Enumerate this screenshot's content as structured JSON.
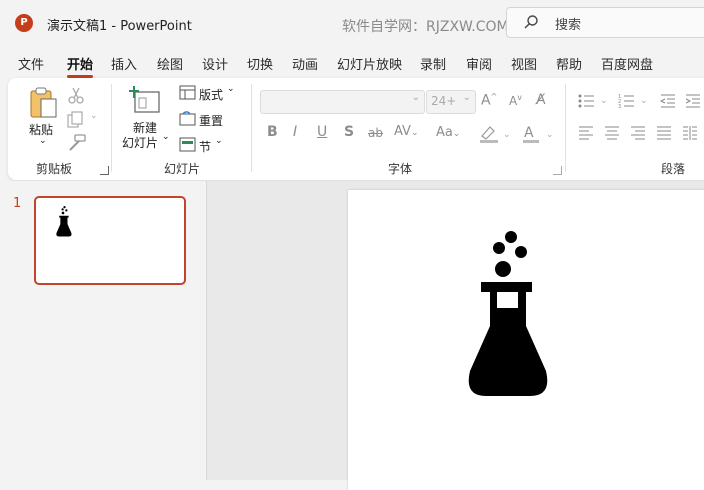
{
  "titlebar": {
    "app_badge": "P",
    "doc_title": "演示文稿1  -  PowerPoint",
    "watermark": "软件自学网：RJZXW.COM",
    "search_placeholder": "搜索"
  },
  "tabs": [
    {
      "label": "文件"
    },
    {
      "label": "开始",
      "active": true
    },
    {
      "label": "插入"
    },
    {
      "label": "绘图"
    },
    {
      "label": "设计"
    },
    {
      "label": "切换"
    },
    {
      "label": "动画"
    },
    {
      "label": "幻灯片放映"
    },
    {
      "label": "录制"
    },
    {
      "label": "审阅"
    },
    {
      "label": "视图"
    },
    {
      "label": "帮助"
    },
    {
      "label": "百度网盘"
    }
  ],
  "ribbon": {
    "clipboard": {
      "paste": "粘贴",
      "group": "剪贴板"
    },
    "slides": {
      "new_slide_1": "新建",
      "new_slide_2": "幻灯片",
      "layout": "版式",
      "reset": "重置",
      "section": "节",
      "group": "幻灯片"
    },
    "font": {
      "font_name": "",
      "font_size": "24+",
      "group": "字体"
    },
    "paragraph": {
      "group": "段落"
    }
  },
  "thumbs": {
    "slide_number": "1"
  },
  "colors": {
    "accent": "#c43e1c",
    "ribbon_bg": "#ffffff",
    "app_bg": "#f3f3f3"
  },
  "slide": {
    "content_icon": "flask-icon"
  }
}
